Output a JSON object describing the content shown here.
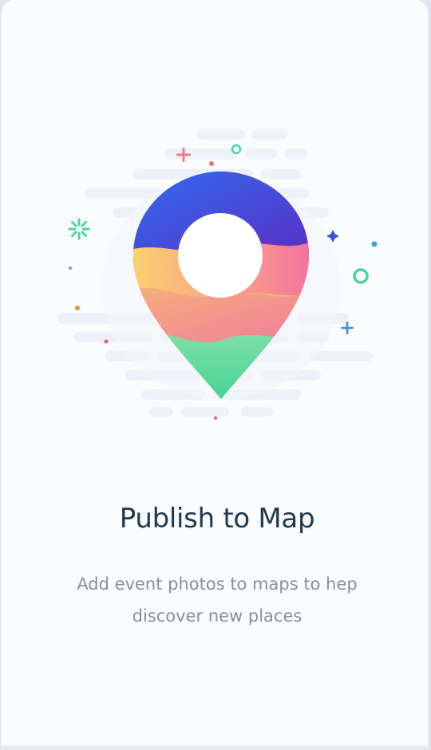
{
  "onboarding": {
    "title": "Publish to Map",
    "description": "Add event photos to maps to hep discover new places"
  },
  "illustration": {
    "icon": "map-pin-icon",
    "colors": {
      "blue": "#3a4fd8",
      "purple": "#6a2ec9",
      "yellow": "#f7cf6c",
      "pink": "#f48aa0",
      "green": "#4bd49b"
    }
  }
}
